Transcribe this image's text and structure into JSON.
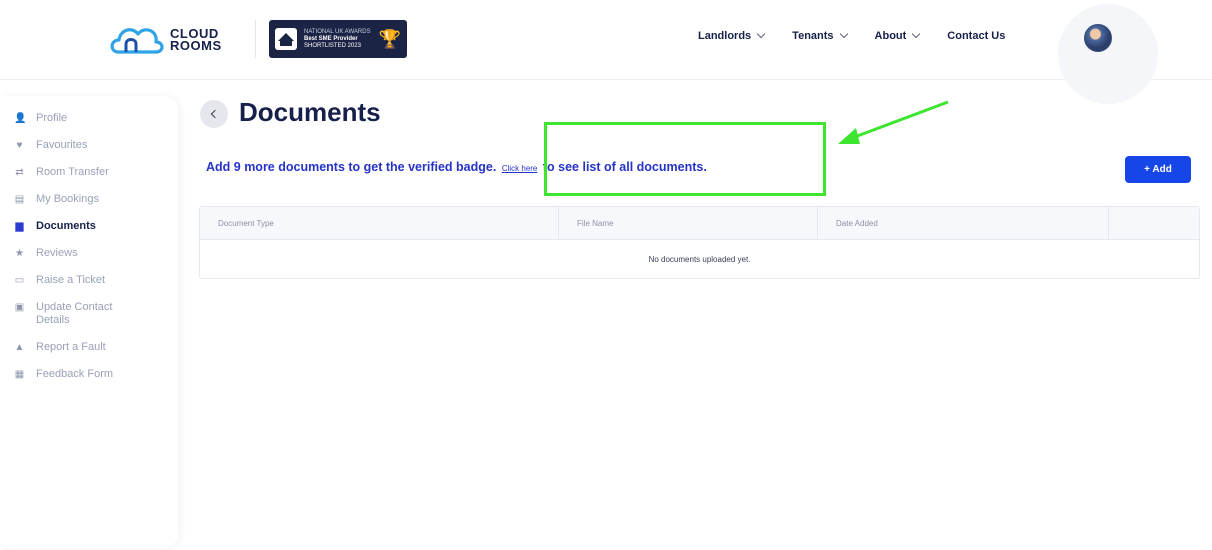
{
  "header": {
    "logo_text_line1": "CLOUD",
    "logo_text_line2": "ROOMS",
    "award": {
      "line1": "NATIONAL UK AWARDS",
      "line2": "Best SME Provider",
      "line3": "SHORTLISTED 2023"
    },
    "nav": [
      {
        "label": "Landlords"
      },
      {
        "label": "Tenants"
      },
      {
        "label": "About"
      },
      {
        "label": "Contact Us"
      }
    ],
    "avatar_icon": "user-avatar"
  },
  "sidebar": {
    "items": [
      {
        "label": "Profile",
        "icon": "👤"
      },
      {
        "label": "Favourites",
        "icon": "♥"
      },
      {
        "label": "Room Transfer",
        "icon": "⇄"
      },
      {
        "label": "My Bookings",
        "icon": "▤"
      },
      {
        "label": "Documents",
        "icon": "▆"
      },
      {
        "label": "Reviews",
        "icon": "★"
      },
      {
        "label": "Raise a Ticket",
        "icon": "▭"
      },
      {
        "label": "Update Contact Details",
        "icon": "▣"
      },
      {
        "label": "Report a Fault",
        "icon": "▲"
      },
      {
        "label": "Feedback Form",
        "icon": "▦"
      }
    ],
    "active_index": 4
  },
  "main": {
    "title": "Documents",
    "notice_prefix": "Add 9 more documents to get the verified badge.",
    "notice_link": "Click here",
    "notice_suffix": "to see list of all documents.",
    "add_button": "+ Add",
    "table": {
      "columns": [
        "Document Type",
        "File Name",
        "Date Added",
        ""
      ],
      "empty_message": "No documents uploaded yet."
    }
  },
  "annotation": {
    "highlight_color": "#3ee52f"
  },
  "colors": {
    "primary": "#1746e8",
    "link": "#2533c8",
    "navy": "#16204a"
  }
}
